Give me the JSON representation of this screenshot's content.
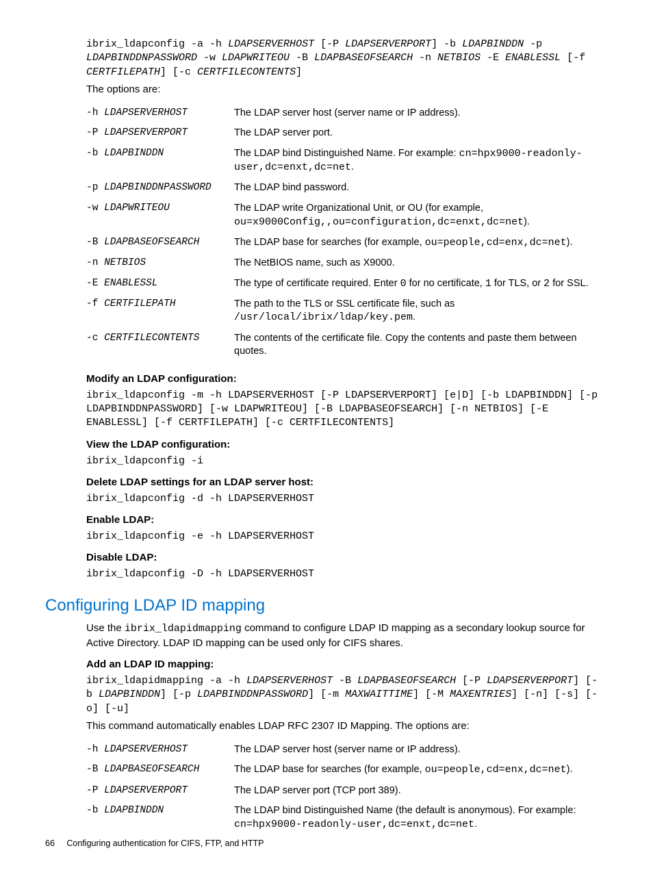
{
  "syntax1": {
    "t1": "ibrix_ldapconfig -a -h ",
    "a1": "LDAPSERVERHOST",
    "t2": " [-P ",
    "a2": "LDAPSERVERPORT",
    "t3": "] -b ",
    "a3": "LDAPBINDDN",
    "t4": " -p ",
    "a4": "LDAPBINDDNPASSWORD",
    "t5": " -w ",
    "a5": "LDAPWRITEOU",
    "t6": " -B ",
    "a6": "LDAPBASEOFSEARCH",
    "t7": " -n ",
    "a7": "NETBIOS",
    "t8": " -E ",
    "a8": "ENABLESSL",
    "t9": " [-f ",
    "a9": "CERTFILEPATH",
    "t10": "] [-c ",
    "a10": "CERTFILECONTENTS",
    "t11": "]"
  },
  "options_intro": "The options are:",
  "table1": [
    {
      "flag": "-h",
      "arg": "LDAPSERVERHOST",
      "desc": "The LDAP server host (server name or IP address)."
    },
    {
      "flag": "-P",
      "arg": "LDAPSERVERPORT",
      "desc": "The LDAP server port."
    },
    {
      "flag": "-b",
      "arg": "LDAPBINDDN",
      "desc_pre": "The LDAP bind Distinguished Name. For example: ",
      "code": "cn=hpx9000-readonly-user,dc=enxt,dc=net",
      "desc_post": "."
    },
    {
      "flag": "-p",
      "arg": "LDAPBINDDNPASSWORD",
      "desc": "The LDAP bind password."
    },
    {
      "flag": "-w",
      "arg": "LDAPWRITEOU",
      "desc_pre": "The LDAP write Organizational Unit, or OU (for example, ",
      "code": "ou=x9000Config,,ou=configuration,dc=enxt,dc=net",
      "desc_post": ")."
    },
    {
      "flag": "-B",
      "arg": "LDAPBASEOFSEARCH",
      "desc_pre": "The LDAP base for searches (for example, ",
      "code": "ou=people,cd=enx,dc=net",
      "desc_post": ")."
    },
    {
      "flag": "-n",
      "arg": "NETBIOS",
      "desc": "The NetBIOS name, such as X9000."
    },
    {
      "flag": "-E",
      "arg": "ENABLESSL",
      "desc_pre": "The type of certificate required. Enter ",
      "code": "0",
      "mid1": " for no certificate, ",
      "code2": "1",
      "mid2": " for TLS, or ",
      "code3": "2",
      "desc_post": " for SSL."
    },
    {
      "flag": "-f",
      "arg": "CERTFILEPATH",
      "desc_pre": "The path to the TLS or SSL certificate file, such as ",
      "code": "/usr/local/ibrix/ldap/key.pem",
      "desc_post": "."
    },
    {
      "flag": "-c",
      "arg": "CERTFILECONTENTS",
      "desc": "The contents of the certificate file. Copy the contents and paste them between quotes."
    }
  ],
  "h_modify": "Modify an LDAP configuration:",
  "modify_cmd": "ibrix_ldapconfig -m -h LDAPSERVERHOST [-P LDAPSERVERPORT] [e|D] [-b LDAPBINDDN] [-p LDAPBINDDNPASSWORD] [-w LDAPWRITEOU] [-B LDAPBASEOFSEARCH] [-n NETBIOS] [-E ENABLESSL] [-f CERTFILEPATH] [-c CERTFILECONTENTS]",
  "h_view": "View the LDAP configuration:",
  "view_cmd": "ibrix_ldapconfig -i",
  "h_delete": "Delete LDAP settings for an LDAP server host:",
  "delete_cmd": "ibrix_ldapconfig -d -h LDAPSERVERHOST",
  "h_enable": "Enable LDAP:",
  "enable_cmd": "ibrix_ldapconfig -e -h LDAPSERVERHOST",
  "h_disable": "Disable LDAP:",
  "disable_cmd": "ibrix_ldapconfig -D -h LDAPSERVERHOST",
  "section_title": "Configuring LDAP ID mapping",
  "section_intro_pre": "Use the ",
  "section_intro_code": "ibrix_ldapidmapping",
  "section_intro_post": " command to configure LDAP ID mapping as a secondary lookup source for Active Directory. LDAP ID mapping can be used only for CIFS shares.",
  "h_add": "Add an LDAP ID mapping:",
  "syntax2": {
    "t1": "ibrix_ldapidmapping -a -h ",
    "a1": "LDAPSERVERHOST",
    "t2": " -B ",
    "a2": "LDAPBASEOFSEARCH",
    "t3": " [-P ",
    "a3": "LDAPSERVERPORT",
    "t4": "] [-b ",
    "a4": "LDAPBINDDN",
    "t5": "] [-p ",
    "a5": "LDAPBINDDNPASSWORD",
    "t6": "] [-m ",
    "a6": "MAXWAITTIME",
    "t7": "] [-M ",
    "a7": "MAXENTRIES",
    "t8": "] [-n] [-s] [-o] [-u]"
  },
  "add_note": "This command automatically enables LDAP RFC 2307 ID Mapping. The options are:",
  "table2": [
    {
      "flag": "-h",
      "arg": "LDAPSERVERHOST",
      "desc": "The LDAP server host (server name or IP address)."
    },
    {
      "flag": "-B",
      "arg": "LDAPBASEOFSEARCH",
      "desc_pre": "The LDAP base for searches (for example, ",
      "code": "ou=people,cd=enx,dc=net",
      "desc_post": ")."
    },
    {
      "flag": "-P",
      "arg": "LDAPSERVERPORT",
      "desc": "The LDAP server port (TCP port 389)."
    },
    {
      "flag": "-b",
      "arg": "LDAPBINDDN",
      "desc_pre": "The LDAP bind Distinguished Name (the default is anonymous). For example: ",
      "code": "cn=hpx9000-readonly-user,dc=enxt,dc=net",
      "desc_post": "."
    }
  ],
  "footer": {
    "page": "66",
    "title": "Configuring authentication for CIFS, FTP, and HTTP"
  }
}
